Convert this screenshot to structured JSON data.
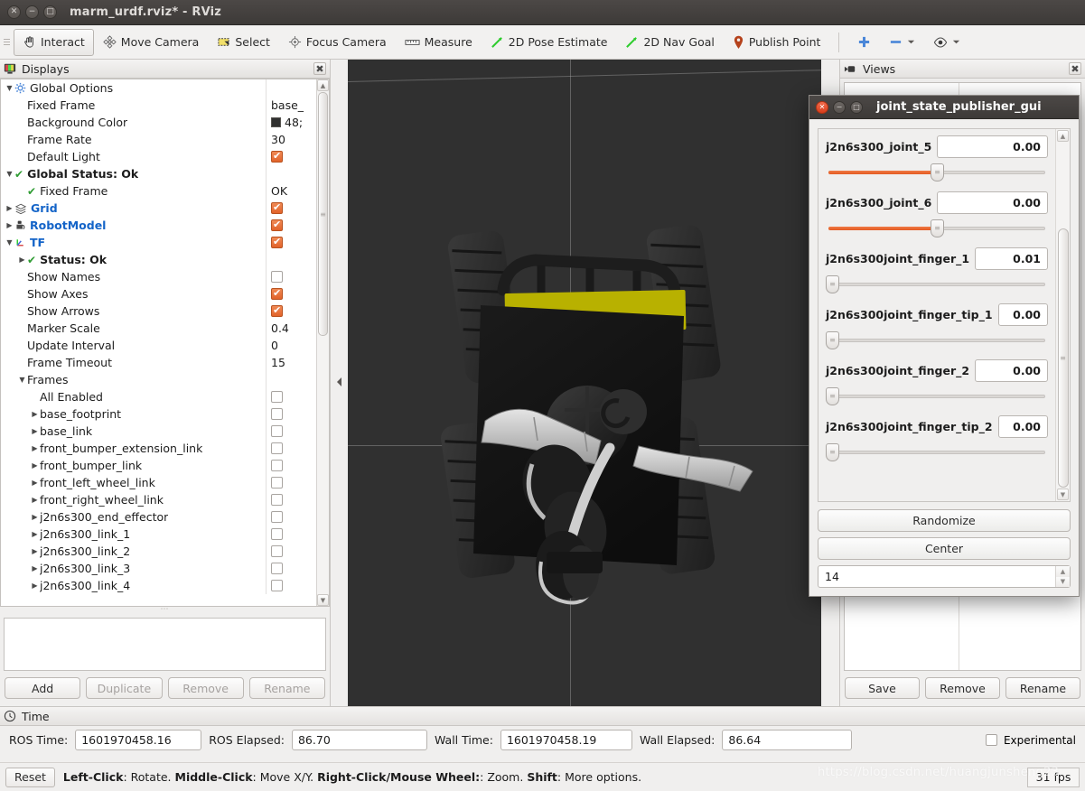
{
  "window": {
    "title": "marm_urdf.rviz* - RViz",
    "buttons": [
      {
        "name": "close",
        "glyph": "✕"
      },
      {
        "name": "minimize",
        "glyph": "−"
      },
      {
        "name": "maximize",
        "glyph": "□"
      }
    ]
  },
  "toolbar": {
    "items": [
      {
        "label": "Interact",
        "icon": "hand-icon",
        "active": true
      },
      {
        "label": "Move Camera",
        "icon": "move-camera-icon",
        "active": false
      },
      {
        "label": "Select",
        "icon": "select-icon",
        "active": false
      },
      {
        "label": "Focus Camera",
        "icon": "focus-camera-icon",
        "active": false
      },
      {
        "label": "Measure",
        "icon": "ruler-icon",
        "active": false
      },
      {
        "label": "2D Pose Estimate",
        "icon": "pose-arrow-icon",
        "active": false
      },
      {
        "label": "2D Nav Goal",
        "icon": "nav-arrow-icon",
        "active": false
      },
      {
        "label": "Publish Point",
        "icon": "map-pin-icon",
        "active": false
      }
    ],
    "extras": [
      {
        "name": "add-panel-icon",
        "glyph": "✚"
      },
      {
        "name": "remove-panel-icon",
        "glyph": "▬"
      },
      {
        "name": "visibility-icon",
        "glyph": "◉"
      }
    ]
  },
  "displays": {
    "title": "Displays",
    "icon": "displays-monitor-icon",
    "close_glyph": "✖",
    "rows": [
      {
        "label": "Global Options",
        "indent": 0,
        "arrow": "down",
        "icon": "gear-icon",
        "style": "plain",
        "value_type": "none"
      },
      {
        "label": "Fixed Frame",
        "indent": 1,
        "arrow": "none",
        "icon": "",
        "style": "plain",
        "value_type": "text",
        "value": "base_"
      },
      {
        "label": "Background Color",
        "indent": 1,
        "arrow": "none",
        "icon": "",
        "style": "plain",
        "value_type": "color",
        "value": "48;",
        "color": "#303030"
      },
      {
        "label": "Frame Rate",
        "indent": 1,
        "arrow": "none",
        "icon": "",
        "style": "plain",
        "value_type": "text",
        "value": "30"
      },
      {
        "label": "Default Light",
        "indent": 1,
        "arrow": "none",
        "icon": "",
        "style": "plain",
        "value_type": "check_on"
      },
      {
        "label": "Global Status: Ok",
        "indent": 0,
        "arrow": "down",
        "icon": "check-green-icon",
        "style": "bold",
        "value_type": "none"
      },
      {
        "label": "Fixed Frame",
        "indent": 1,
        "arrow": "none",
        "icon": "check-green-icon",
        "style": "plain",
        "value_type": "text",
        "value": "OK"
      },
      {
        "label": "Grid",
        "indent": 0,
        "arrow": "right",
        "icon": "grid-icon",
        "style": "blue",
        "value_type": "check_on"
      },
      {
        "label": "RobotModel",
        "indent": 0,
        "arrow": "right",
        "icon": "robot-icon",
        "style": "blue",
        "value_type": "check_on"
      },
      {
        "label": "TF",
        "indent": 0,
        "arrow": "down",
        "icon": "axes-icon",
        "style": "blue",
        "value_type": "check_on"
      },
      {
        "label": "Status: Ok",
        "indent": 1,
        "arrow": "right",
        "icon": "check-green-icon",
        "style": "bold",
        "value_type": "none"
      },
      {
        "label": "Show Names",
        "indent": 1,
        "arrow": "none",
        "icon": "",
        "style": "plain",
        "value_type": "check_off"
      },
      {
        "label": "Show Axes",
        "indent": 1,
        "arrow": "none",
        "icon": "",
        "style": "plain",
        "value_type": "check_on"
      },
      {
        "label": "Show Arrows",
        "indent": 1,
        "arrow": "none",
        "icon": "",
        "style": "plain",
        "value_type": "check_on"
      },
      {
        "label": "Marker Scale",
        "indent": 1,
        "arrow": "none",
        "icon": "",
        "style": "plain",
        "value_type": "text",
        "value": "0.4"
      },
      {
        "label": "Update Interval",
        "indent": 1,
        "arrow": "none",
        "icon": "",
        "style": "plain",
        "value_type": "text",
        "value": "0"
      },
      {
        "label": "Frame Timeout",
        "indent": 1,
        "arrow": "none",
        "icon": "",
        "style": "plain",
        "value_type": "text",
        "value": "15"
      },
      {
        "label": "Frames",
        "indent": 1,
        "arrow": "down",
        "icon": "",
        "style": "plain",
        "value_type": "none"
      },
      {
        "label": "All Enabled",
        "indent": 2,
        "arrow": "none",
        "icon": "",
        "style": "plain",
        "value_type": "check_off"
      },
      {
        "label": "base_footprint",
        "indent": 2,
        "arrow": "right",
        "icon": "",
        "style": "plain",
        "value_type": "check_off"
      },
      {
        "label": "base_link",
        "indent": 2,
        "arrow": "right",
        "icon": "",
        "style": "plain",
        "value_type": "check_off"
      },
      {
        "label": "front_bumper_extension_link",
        "indent": 2,
        "arrow": "right",
        "icon": "",
        "style": "plain",
        "value_type": "check_off"
      },
      {
        "label": "front_bumper_link",
        "indent": 2,
        "arrow": "right",
        "icon": "",
        "style": "plain",
        "value_type": "check_off"
      },
      {
        "label": "front_left_wheel_link",
        "indent": 2,
        "arrow": "right",
        "icon": "",
        "style": "plain",
        "value_type": "check_off"
      },
      {
        "label": "front_right_wheel_link",
        "indent": 2,
        "arrow": "right",
        "icon": "",
        "style": "plain",
        "value_type": "check_off"
      },
      {
        "label": "j2n6s300_end_effector",
        "indent": 2,
        "arrow": "right",
        "icon": "",
        "style": "plain",
        "value_type": "check_off"
      },
      {
        "label": "j2n6s300_link_1",
        "indent": 2,
        "arrow": "right",
        "icon": "",
        "style": "plain",
        "value_type": "check_off"
      },
      {
        "label": "j2n6s300_link_2",
        "indent": 2,
        "arrow": "right",
        "icon": "",
        "style": "plain",
        "value_type": "check_off"
      },
      {
        "label": "j2n6s300_link_3",
        "indent": 2,
        "arrow": "right",
        "icon": "",
        "style": "plain",
        "value_type": "check_off"
      },
      {
        "label": "j2n6s300_link_4",
        "indent": 2,
        "arrow": "right",
        "icon": "",
        "style": "plain",
        "value_type": "check_off"
      }
    ],
    "buttons": [
      {
        "label": "Add",
        "enabled": true
      },
      {
        "label": "Duplicate",
        "enabled": false
      },
      {
        "label": "Remove",
        "enabled": false
      },
      {
        "label": "Rename",
        "enabled": false
      }
    ]
  },
  "views": {
    "title": "Views",
    "icon": "camera-icon",
    "close_glyph": "✖",
    "buttons": [
      {
        "label": "Save"
      },
      {
        "label": "Remove"
      },
      {
        "label": "Rename"
      }
    ]
  },
  "joint_dialog": {
    "title": "joint_state_publisher_gui",
    "buttons": [
      {
        "name": "close",
        "glyph": "✕"
      },
      {
        "name": "minimize",
        "glyph": "−"
      },
      {
        "name": "maximize",
        "glyph": "□"
      }
    ],
    "joints": [
      {
        "name": "j2n6s300_joint_5",
        "value": "0.00",
        "percent": 50
      },
      {
        "name": "j2n6s300_joint_6",
        "value": "0.00",
        "percent": 50
      },
      {
        "name": "j2n6s300joint_finger_1",
        "value": "0.01",
        "percent": 0
      },
      {
        "name": "j2n6s300joint_finger_tip_1",
        "value": "0.00",
        "percent": 0
      },
      {
        "name": "j2n6s300joint_finger_2",
        "value": "0.00",
        "percent": 0
      },
      {
        "name": "j2n6s300joint_finger_tip_2",
        "value": "0.00",
        "percent": 0
      }
    ],
    "randomize_label": "Randomize",
    "center_label": "Center",
    "spin_value": "14"
  },
  "time": {
    "title": "Time",
    "icon": "clock-icon",
    "fields": [
      {
        "label": "ROS Time:",
        "value": "1601970458.16"
      },
      {
        "label": "ROS Elapsed:",
        "value": "86.70"
      },
      {
        "label": "Wall Time:",
        "value": "1601970458.19"
      },
      {
        "label": "Wall Elapsed:",
        "value": "86.64"
      }
    ],
    "experimental_label": "Experimental",
    "experimental_checked": false
  },
  "status": {
    "reset_label": "Reset",
    "hint_parts": [
      {
        "text": "Left-Click",
        "bold": true
      },
      {
        "text": ": Rotate. ",
        "bold": false
      },
      {
        "text": "Middle-Click",
        "bold": true
      },
      {
        "text": ": Move X/Y. ",
        "bold": false
      },
      {
        "text": "Right-Click/Mouse Wheel:",
        "bold": true
      },
      {
        "text": ": Zoom. ",
        "bold": false
      },
      {
        "text": "Shift",
        "bold": true
      },
      {
        "text": ": More options.",
        "bold": false
      }
    ],
    "fps": "31 fps",
    "watermark": "https://blog.csdn.net/huangjunsheng23"
  },
  "viewport": {
    "background": "#303030",
    "chassis_color": "#151515",
    "accent_color": "#b8b100",
    "arm_light": "#c8c8c8"
  }
}
